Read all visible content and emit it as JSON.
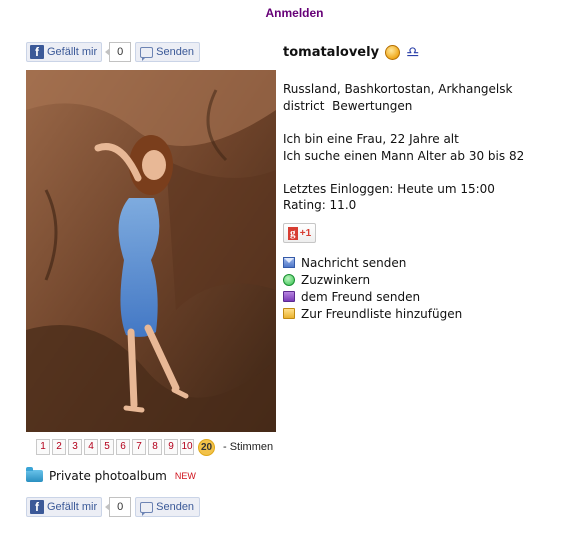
{
  "header": {
    "login_label": "Anmelden"
  },
  "social_top": {
    "like_label": "Gefällt mir",
    "like_count": "0",
    "send_label": "Senden"
  },
  "social_bottom": {
    "like_label": "Gefällt mir",
    "like_count": "0",
    "send_label": "Senden"
  },
  "profile": {
    "username": "tomatalovely",
    "location_line1": "Russland, Bashkortostan, Arkhangelsk",
    "location_line2": "district",
    "ratings_link": "Bewertungen",
    "about_line1": "Ich bin eine Frau, 22 Jahre alt",
    "about_line2": "Ich suche einen Mann Alter ab 30 bis 82",
    "last_login": "Letztes Einloggen: Heute um 15:00",
    "rating": "Rating: 11.0",
    "gplus_label": "+1",
    "gplus_letter": "g"
  },
  "actions": [
    {
      "label": "Nachricht senden",
      "icon": "mail-icon"
    },
    {
      "label": "Zuzwinkern",
      "icon": "wink-icon"
    },
    {
      "label": "dem Freund senden",
      "icon": "friend-icon"
    },
    {
      "label": "Zur Freundliste hinzufügen",
      "icon": "folder-icon"
    }
  ],
  "rating_scale": {
    "options": [
      "1",
      "2",
      "3",
      "4",
      "5",
      "6",
      "7",
      "8",
      "9",
      "10"
    ],
    "current": "20",
    "votes_label": "- Stimmen"
  },
  "album": {
    "label": "Private photoalbum",
    "badge": "NEW"
  }
}
